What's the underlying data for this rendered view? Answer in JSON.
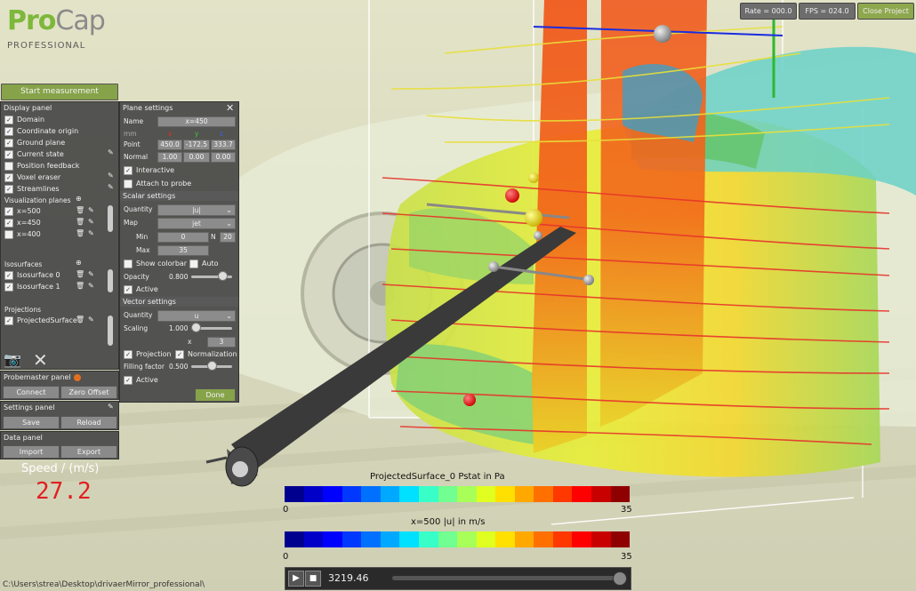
{
  "app": {
    "logo_pro": "Pro",
    "logo_cap": "Cap",
    "logo_sub": "PROFESSIONAL"
  },
  "top_buttons": {
    "rate": "Rate = 000.0",
    "fps": "FPS = 024.0",
    "close": "Close Project"
  },
  "start_button": "Start measurement",
  "display_panel": {
    "title": "Display panel",
    "items": [
      {
        "label": "Domain",
        "checked": true
      },
      {
        "label": "Coordinate origin",
        "checked": true
      },
      {
        "label": "Ground plane",
        "checked": true
      },
      {
        "label": "Current state",
        "checked": true
      },
      {
        "label": "Position feedback",
        "checked": false
      },
      {
        "label": "Voxel eraser",
        "checked": true
      },
      {
        "label": "Streamlines",
        "checked": true
      }
    ],
    "vis_planes_label": "Visualization planes",
    "planes": [
      {
        "label": "x=500",
        "checked": true
      },
      {
        "label": "x=450",
        "checked": true
      },
      {
        "label": "x=400",
        "checked": false
      }
    ],
    "isosurfaces_label": "Isosurfaces",
    "isosurfaces": [
      {
        "label": "Isosurface 0",
        "checked": true
      },
      {
        "label": "Isosurface 1",
        "checked": true
      }
    ],
    "projections_label": "Projections",
    "projections": [
      {
        "label": "ProjectedSurface",
        "checked": true
      }
    ]
  },
  "probemaster": {
    "title": "Probemaster panel",
    "connect": "Connect",
    "zero": "Zero Offset"
  },
  "settings": {
    "title": "Settings panel",
    "save": "Save",
    "reload": "Reload"
  },
  "data_panel": {
    "title": "Data panel",
    "import": "Import",
    "export": "Export"
  },
  "speed": {
    "label": "Speed / (m/s)",
    "value": "27.2"
  },
  "path": "C:\\Users\\strea\\Desktop\\drivaerMirror_professional\\",
  "plane_settings": {
    "title": "Plane settings",
    "name_label": "Name",
    "name_value": "x=450",
    "mm": "mm",
    "x": "x",
    "y": "y",
    "z": "z",
    "point_label": "Point",
    "point": [
      "450.0",
      "-172.5",
      "333.7"
    ],
    "normal_label": "Normal",
    "normal": [
      "1.00",
      "0.00",
      "0.00"
    ],
    "interactive": "Interactive",
    "attach": "Attach to probe",
    "scalar_title": "Scalar settings",
    "quantity_label": "Quantity",
    "quantity_value": "|u|",
    "map_label": "Map",
    "map_value": "jet",
    "min_label": "Min",
    "min_value": "0",
    "n_label": "N",
    "n_value": "20",
    "max_label": "Max",
    "max_value": "35",
    "show_colorbar": "Show colorbar",
    "auto": "Auto",
    "opacity_label": "Opacity",
    "opacity_value": "0.800",
    "active": "Active",
    "vector_title": "Vector settings",
    "vquantity_value": "u",
    "scaling_label": "Scaling",
    "scaling_value": "1.000",
    "x_label": "x",
    "x_value": "3",
    "projection": "Projection",
    "normalization": "Normalization",
    "filling_label": "Filling factor",
    "filling_value": "0.500",
    "vactive": "Active",
    "done": "Done"
  },
  "colorbar1": {
    "title": "ProjectedSurface_0 Pstat in Pa",
    "min": "0",
    "max": "35"
  },
  "colorbar2": {
    "title": "x=500 |u| in m/s",
    "min": "0",
    "max": "35"
  },
  "playback": {
    "time": "3219.46"
  },
  "colors": {
    "accent": "#7cb83a",
    "speed": "#e02020"
  }
}
